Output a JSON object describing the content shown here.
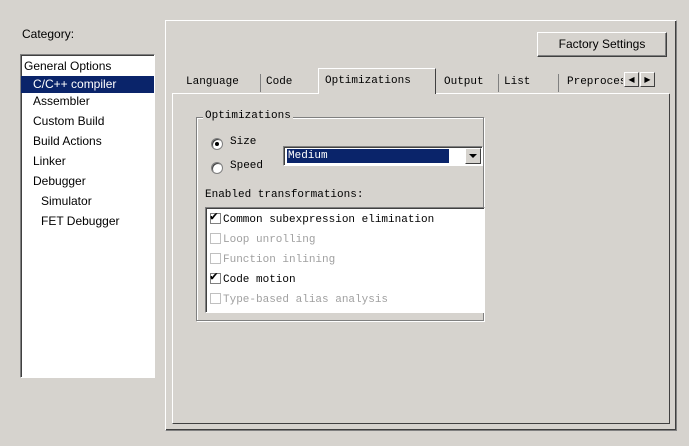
{
  "category": {
    "label": "Category:",
    "items": [
      {
        "label": "General Options",
        "indent": false,
        "selected": false
      },
      {
        "label": "C/C++ compiler",
        "indent": true,
        "selected": true
      },
      {
        "label": "Assembler",
        "indent": false,
        "selected": false
      },
      {
        "label": "Custom Build",
        "indent": false,
        "selected": false
      },
      {
        "label": "Build Actions",
        "indent": false,
        "selected": false
      },
      {
        "label": "Linker",
        "indent": false,
        "selected": false
      },
      {
        "label": "Debugger",
        "indent": false,
        "selected": false
      },
      {
        "label": "Simulator",
        "indent": true,
        "selected": false
      },
      {
        "label": "FET Debugger",
        "indent": true,
        "selected": false
      }
    ]
  },
  "factory_settings": "Factory Settings",
  "tabs": {
    "language": "Language",
    "code": "Code",
    "optimizations": "Optimizations",
    "output": "Output",
    "list": "List",
    "preprocessor": "Preproces"
  },
  "optimizations": {
    "group_title": "Optimizations",
    "size_label": "Size",
    "speed_label": "Speed",
    "selected_goal": "Size",
    "level_value": "Medium",
    "transformations_label": "Enabled transformations:",
    "transformations": [
      {
        "label": "Common subexpression elimination",
        "checked": true,
        "enabled": true
      },
      {
        "label": "Loop unrolling",
        "checked": false,
        "enabled": false
      },
      {
        "label": "Function inlining",
        "checked": false,
        "enabled": false
      },
      {
        "label": "Code motion",
        "checked": true,
        "enabled": true
      },
      {
        "label": "Type-based alias analysis",
        "checked": false,
        "enabled": false
      }
    ]
  },
  "icons": {
    "radio_selected": "radio-selected-icon",
    "checkmark": "checkmark-icon",
    "combo_arrow": "chevron-down-icon",
    "tab_left": "arrow-left-icon",
    "tab_right": "arrow-right-icon"
  },
  "colors": {
    "face": "#d6d3ce",
    "selection": "#0a246a",
    "disabled_text": "#a0a0a0"
  }
}
